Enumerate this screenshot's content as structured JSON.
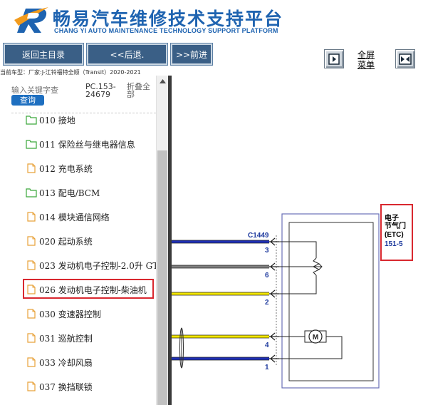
{
  "header": {
    "title_cn": "畅易汽车维修技术支持平台",
    "title_en": "CHANG YI AUTO MAINTENANCE TECHNOLOGY SUPPORT PLATFORM"
  },
  "toolbar": {
    "home_label": "返回主目录",
    "back_label": "<<后退.",
    "forward_label": ">>前进",
    "fullscreen_label": "全屏菜单"
  },
  "model_line": "当前车型：厂家:J-江铃福特全顺（Transit）2020-2021",
  "sidebar": {
    "search_placeholder": "输入关键字查",
    "search_button": "查询",
    "pc_code": "PC.153-24679",
    "collapse_all": "折叠全部",
    "items": [
      {
        "label": "010 接地",
        "icon": "folder-icon"
      },
      {
        "label": "011 保险丝与继电器信息",
        "icon": "folder-icon"
      },
      {
        "label": "012 充电系统",
        "icon": "document-icon"
      },
      {
        "label": "013 配电/BCM",
        "icon": "folder-icon"
      },
      {
        "label": "014 模块通信网络",
        "icon": "document-icon"
      },
      {
        "label": "020 起动系统",
        "icon": "document-icon"
      },
      {
        "label": "023 发动机电子控制-2.0升 GT",
        "icon": "document-icon"
      },
      {
        "label": "026 发动机电子控制-柴油机",
        "icon": "document-icon"
      },
      {
        "label": "030 变速器控制",
        "icon": "document-icon"
      },
      {
        "label": "031 巡航控制",
        "icon": "document-icon"
      },
      {
        "label": "033 冷却风扇",
        "icon": "document-icon"
      },
      {
        "label": "037 换挡联锁",
        "icon": "document-icon"
      }
    ]
  },
  "diagram": {
    "component_name_1": "电子",
    "component_name_2": "节气门",
    "component_abbr": "(ETC)",
    "component_ref": "151-5",
    "connector": "C1449",
    "pins": [
      "3",
      "6",
      "2",
      "4",
      "1"
    ],
    "colors": {
      "blue_wire": "#1f2fb5",
      "gray_wire": "#808080",
      "yellow_wire": "#f2e600",
      "highlight": "#d9282f"
    }
  }
}
